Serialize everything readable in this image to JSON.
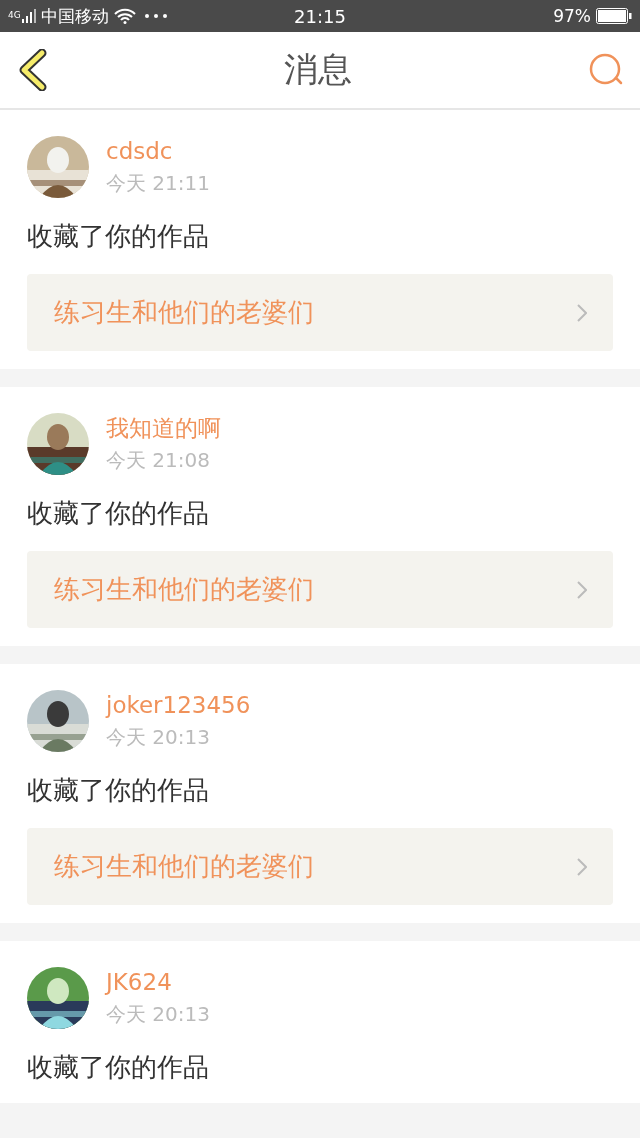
{
  "status_bar": {
    "network": "4G",
    "carrier": "中国移动",
    "time": "21:15",
    "battery": "97%"
  },
  "header": {
    "title": "消息"
  },
  "messages": [
    {
      "user": "cdsdc",
      "time": "今天 21:11",
      "action": "收藏了你的作品",
      "work": "练习生和他们的老婆们"
    },
    {
      "user": "我知道的啊",
      "time": "今天 21:08",
      "action": "收藏了你的作品",
      "work": "练习生和他们的老婆们"
    },
    {
      "user": "joker123456",
      "time": "今天 20:13",
      "action": "收藏了你的作品",
      "work": "练习生和他们的老婆们"
    },
    {
      "user": "JK624",
      "time": "今天 20:13",
      "action": "收藏了你的作品"
    }
  ]
}
